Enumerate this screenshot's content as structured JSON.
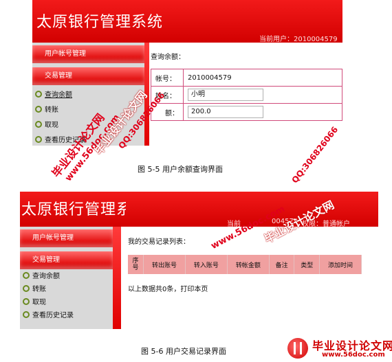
{
  "screenshot1": {
    "app_title": "太原银行管理系统",
    "current_user": "当前用户：2010004579",
    "menu_sections": [
      "用户帐号管理",
      "交易管理"
    ],
    "menu_items": [
      {
        "label": "查询余额"
      },
      {
        "label": "转账"
      },
      {
        "label": "取现"
      },
      {
        "label": "查看历史记录"
      }
    ],
    "content_title": "查询余额：",
    "form": [
      {
        "label": "帐号：",
        "value": "2010004579"
      },
      {
        "label": "姓名：",
        "value": "小明"
      },
      {
        "label": "额：",
        "value": "200.0"
      }
    ]
  },
  "caption1": "图 5-5  用户余额查询界面",
  "screenshot2": {
    "app_title": "太原银行管理系统",
    "user_prefix": "当前",
    "user_suffix": "004579",
    "role": "权限：普通帐户",
    "menu_sections": [
      "用户帐号管理",
      "交易管理"
    ],
    "menu_items": [
      {
        "label": "查询余额"
      },
      {
        "label": "转账"
      },
      {
        "label": "取现"
      },
      {
        "label": "查看历史记录"
      }
    ],
    "content_title": "我的交易记录列表：",
    "table_headers": [
      "序号",
      "转出账号",
      "转入账号",
      "转帐金额",
      "备注",
      "类型",
      "添加时间"
    ],
    "footer_note": "以上数据共0条，打印本页"
  },
  "caption2": "图 5-6 用户交易记录界面",
  "watermarks": [
    "毕业设计论文网",
    "www.56doc.com",
    "QQ:306826066",
    "毕业设计论文网",
    "QQ:306826066",
    "www.56doc.com",
    "毕业设计论文网"
  ],
  "logo": {
    "brand": "毕业设计论文网",
    "url": "www.56doc.com"
  },
  "colors": {
    "brand_red": "#e00000",
    "menu_bg": "#d9d9d9",
    "table_header": "#f0a0a0",
    "form_border": "#d04a7a"
  }
}
